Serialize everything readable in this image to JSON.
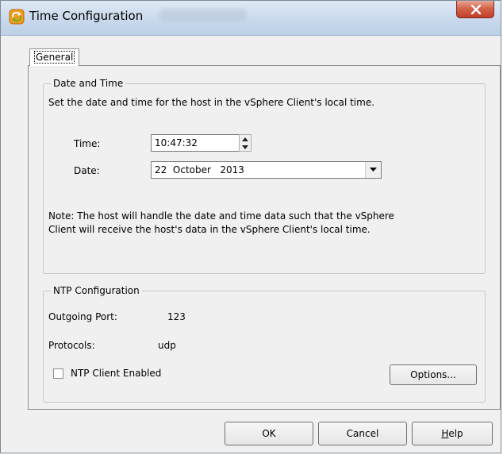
{
  "window": {
    "title": "Time Configuration"
  },
  "tabs": [
    {
      "label": "General"
    }
  ],
  "date_time": {
    "group_title": "Date and Time",
    "description": "Set the date and time for the host in the vSphere Client's local time.",
    "time_label": "Time:",
    "time_value": "10:47:32",
    "date_label": "Date:",
    "date_value": "22  October   2013",
    "note_line1": "Note: The host will handle the date and time data such that the vSphere",
    "note_line2": "Client will receive the host's data in the vSphere Client's local time."
  },
  "ntp": {
    "group_title": "NTP Configuration",
    "port_label": "Outgoing Port:",
    "port_value": "123",
    "protocols_label": "Protocols:",
    "protocols_value": "udp",
    "client_enabled_label": "NTP Client Enabled",
    "client_enabled": false,
    "options_button": "Options..."
  },
  "buttons": {
    "ok": "OK",
    "cancel": "Cancel",
    "help_rest": "elp",
    "help_mnemonic": "H"
  },
  "icons": {
    "app": "vsphere-sync-icon",
    "close": "close-icon",
    "spin_up": "arrow-up-icon",
    "spin_down": "arrow-down-icon",
    "dropdown": "chevron-down-icon"
  },
  "colors": {
    "close_button": "#c94a32",
    "app_icon_orange": "#f29b1d",
    "app_icon_green": "#6fae2d"
  }
}
